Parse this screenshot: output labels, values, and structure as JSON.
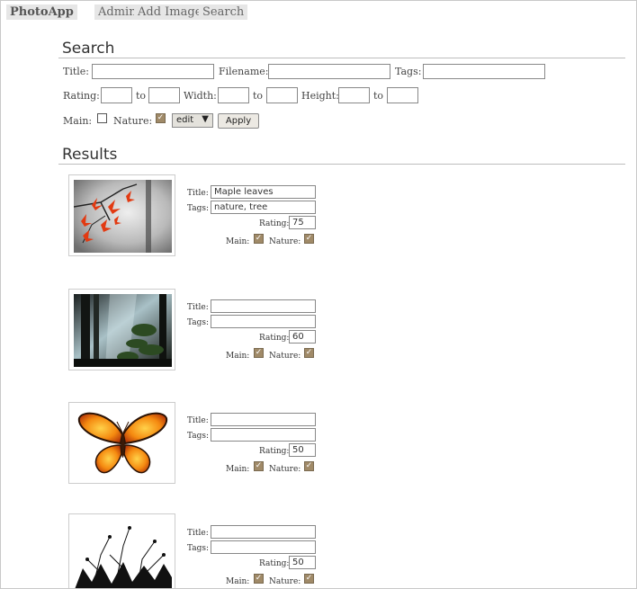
{
  "nav": {
    "brand": "PhotoApp",
    "items": [
      "Admin",
      "Add Image",
      "Search"
    ]
  },
  "search": {
    "heading": "Search",
    "labels": {
      "title": "Title:",
      "filename": "Filename:",
      "tags": "Tags:",
      "rating": "Rating:",
      "to": "to",
      "width": "Width:",
      "height": "Height:",
      "main": "Main:",
      "nature": "Nature:"
    },
    "main_checked": false,
    "nature_checked": true,
    "action_select": "edit",
    "apply_label": "Apply"
  },
  "results": {
    "heading": "Results",
    "labels": {
      "title": "Title:",
      "tags": "Tags:",
      "rating": "Rating:",
      "main": "Main:",
      "nature": "Nature:"
    },
    "items": [
      {
        "image": "maple-leaves",
        "title": "Maple leaves",
        "tags": "nature, tree",
        "rating": "75",
        "main": true,
        "nature": true
      },
      {
        "image": "forest-light",
        "title": "",
        "tags": "",
        "rating": "60",
        "main": true,
        "nature": true
      },
      {
        "image": "butterfly",
        "title": "",
        "tags": "",
        "rating": "50",
        "main": true,
        "nature": true
      },
      {
        "image": "plant-silhouette",
        "title": "",
        "tags": "",
        "rating": "50",
        "main": true,
        "nature": true
      }
    ]
  },
  "colors": {
    "checkbox_checked": "#a08a68",
    "nav_bg": "#e6e6e6",
    "rule": "#bdbdbd"
  }
}
